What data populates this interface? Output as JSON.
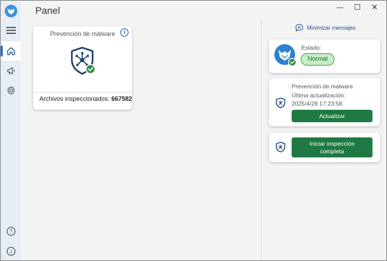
{
  "window": {
    "title": "Panel",
    "controls": {
      "minimize": "—",
      "maximize": "☐",
      "close": "✕"
    }
  },
  "sidebar": {
    "items": [
      {
        "name": "menu",
        "icon": "hamburger-icon"
      },
      {
        "name": "home",
        "icon": "home-icon",
        "active": true
      },
      {
        "name": "notifications",
        "icon": "megaphone-icon"
      },
      {
        "name": "settings",
        "icon": "gear-icon"
      }
    ],
    "bottom": [
      {
        "name": "help",
        "glyph": "?"
      },
      {
        "name": "about",
        "glyph": "i"
      }
    ]
  },
  "main_card": {
    "label": "Prevención de malware",
    "stat_label": "Archivos inspeccionados:",
    "stat_value": "667582"
  },
  "right_panel": {
    "minimize_messages": "Minimizar mensajes",
    "status": {
      "label": "Estado:",
      "value": "Normal"
    },
    "update": {
      "title": "Prevención de malware",
      "last_update_label": "Última actualización:",
      "last_update_value": "2025/4/28 17:23:58",
      "button": "Actualizar"
    },
    "scan": {
      "button_line1": "Iniciar inspección",
      "button_line2": "completa"
    }
  },
  "colors": {
    "accent": "#1e6fd9",
    "brand_blue": "#3d8fd8",
    "shield_dark": "#1e3f6e",
    "ok_green": "#2a8a3a",
    "button_green": "#1e7a42",
    "badge_bg": "#c8ebc8"
  }
}
